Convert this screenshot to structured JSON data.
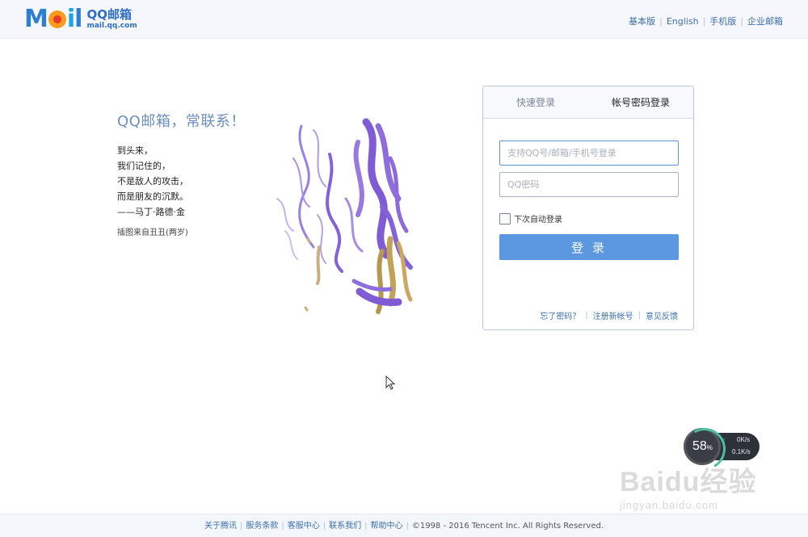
{
  "header": {
    "logo_letters": [
      "M",
      "a",
      "i",
      "l"
    ],
    "logo_cn": "QQ邮箱",
    "logo_url": "mail.qq.com",
    "links": [
      "基本版",
      "English",
      "手机版",
      "企业邮箱"
    ]
  },
  "intro": {
    "title": "QQ邮箱，常联系！",
    "poem": [
      "到头来，",
      "我们记住的，",
      "不是敌人的攻击，",
      "而是朋友的沉默。",
      "——马丁·路德·金"
    ],
    "credit": "插图来自丑丑(两岁)"
  },
  "login": {
    "tabs": [
      "快速登录",
      "帐号密码登录"
    ],
    "active_tab": "帐号密码登录",
    "account_placeholder": "支持QQ号/邮箱/手机号登录",
    "account_value": "",
    "password_placeholder": "QQ密码",
    "password_value": "",
    "remember_label": "下次自动登录",
    "remember_checked": false,
    "submit_label": "登 录",
    "links": [
      "忘了密码？",
      "注册新帐号",
      "意见反馈"
    ]
  },
  "net_widget": {
    "percent": "58",
    "percent_unit": "%",
    "up_value": "0",
    "up_unit": "K/s",
    "down_value": "0.1",
    "down_unit": "K/s"
  },
  "watermark": {
    "brand": "Baidu经验",
    "url": "jingyan.baidu.com"
  },
  "footer": {
    "links": [
      "关于腾讯",
      "服务条款",
      "客服中心",
      "联系我们",
      "帮助中心"
    ],
    "copyright": "©1998 - 2016 Tencent Inc. All Rights Reserved."
  },
  "colors": {
    "accent": "#5b98e0",
    "link": "#3e6fb0",
    "title": "#6b8fc2",
    "paint_purple": "#7b55d6",
    "paint_ochre": "#b8923a"
  }
}
